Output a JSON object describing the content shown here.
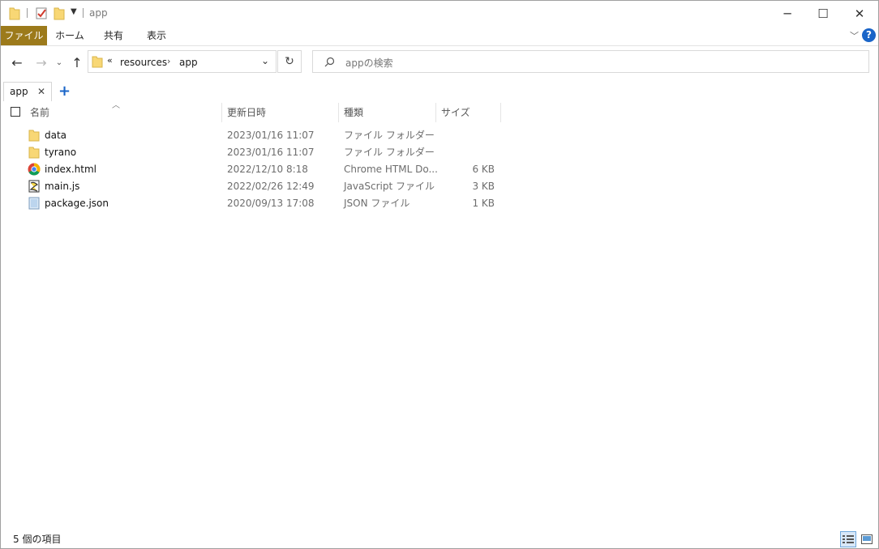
{
  "window": {
    "title": "app",
    "controls": {
      "minimize": "─",
      "maximize": "☐",
      "close": "✕"
    }
  },
  "ribbon": {
    "tabs": [
      "ファイル",
      "ホーム",
      "共有",
      "表示"
    ],
    "help_label": "?"
  },
  "address_bar": {
    "overflow": "«",
    "crumbs": [
      "resources",
      "app"
    ],
    "search_placeholder": "appの検索"
  },
  "tabs": {
    "open_tab": "app",
    "close_glyph": "✕",
    "new_tab_glyph": "+"
  },
  "columns": {
    "name": "名前",
    "date": "更新日時",
    "type": "種類",
    "size": "サイズ"
  },
  "files": [
    {
      "name": "data",
      "date": "2023/01/16 11:07",
      "type": "ファイル フォルダー",
      "size": "",
      "icon": "folder-icon"
    },
    {
      "name": "tyrano",
      "date": "2023/01/16 11:07",
      "type": "ファイル フォルダー",
      "size": "",
      "icon": "folder-icon"
    },
    {
      "name": "index.html",
      "date": "2022/12/10 8:18",
      "type": "Chrome HTML Do...",
      "size": "6 KB",
      "icon": "chrome-icon"
    },
    {
      "name": "main.js",
      "date": "2022/02/26 12:49",
      "type": "JavaScript ファイル",
      "size": "3 KB",
      "icon": "js-file-icon"
    },
    {
      "name": "package.json",
      "date": "2020/09/13 17:08",
      "type": "JSON ファイル",
      "size": "1 KB",
      "icon": "json-file-icon"
    }
  ],
  "status": {
    "item_count": "5 個の項目"
  },
  "colors": {
    "file_tab": "#9c7a1b",
    "folder": "#f8d775",
    "help": "#1a65c8"
  }
}
